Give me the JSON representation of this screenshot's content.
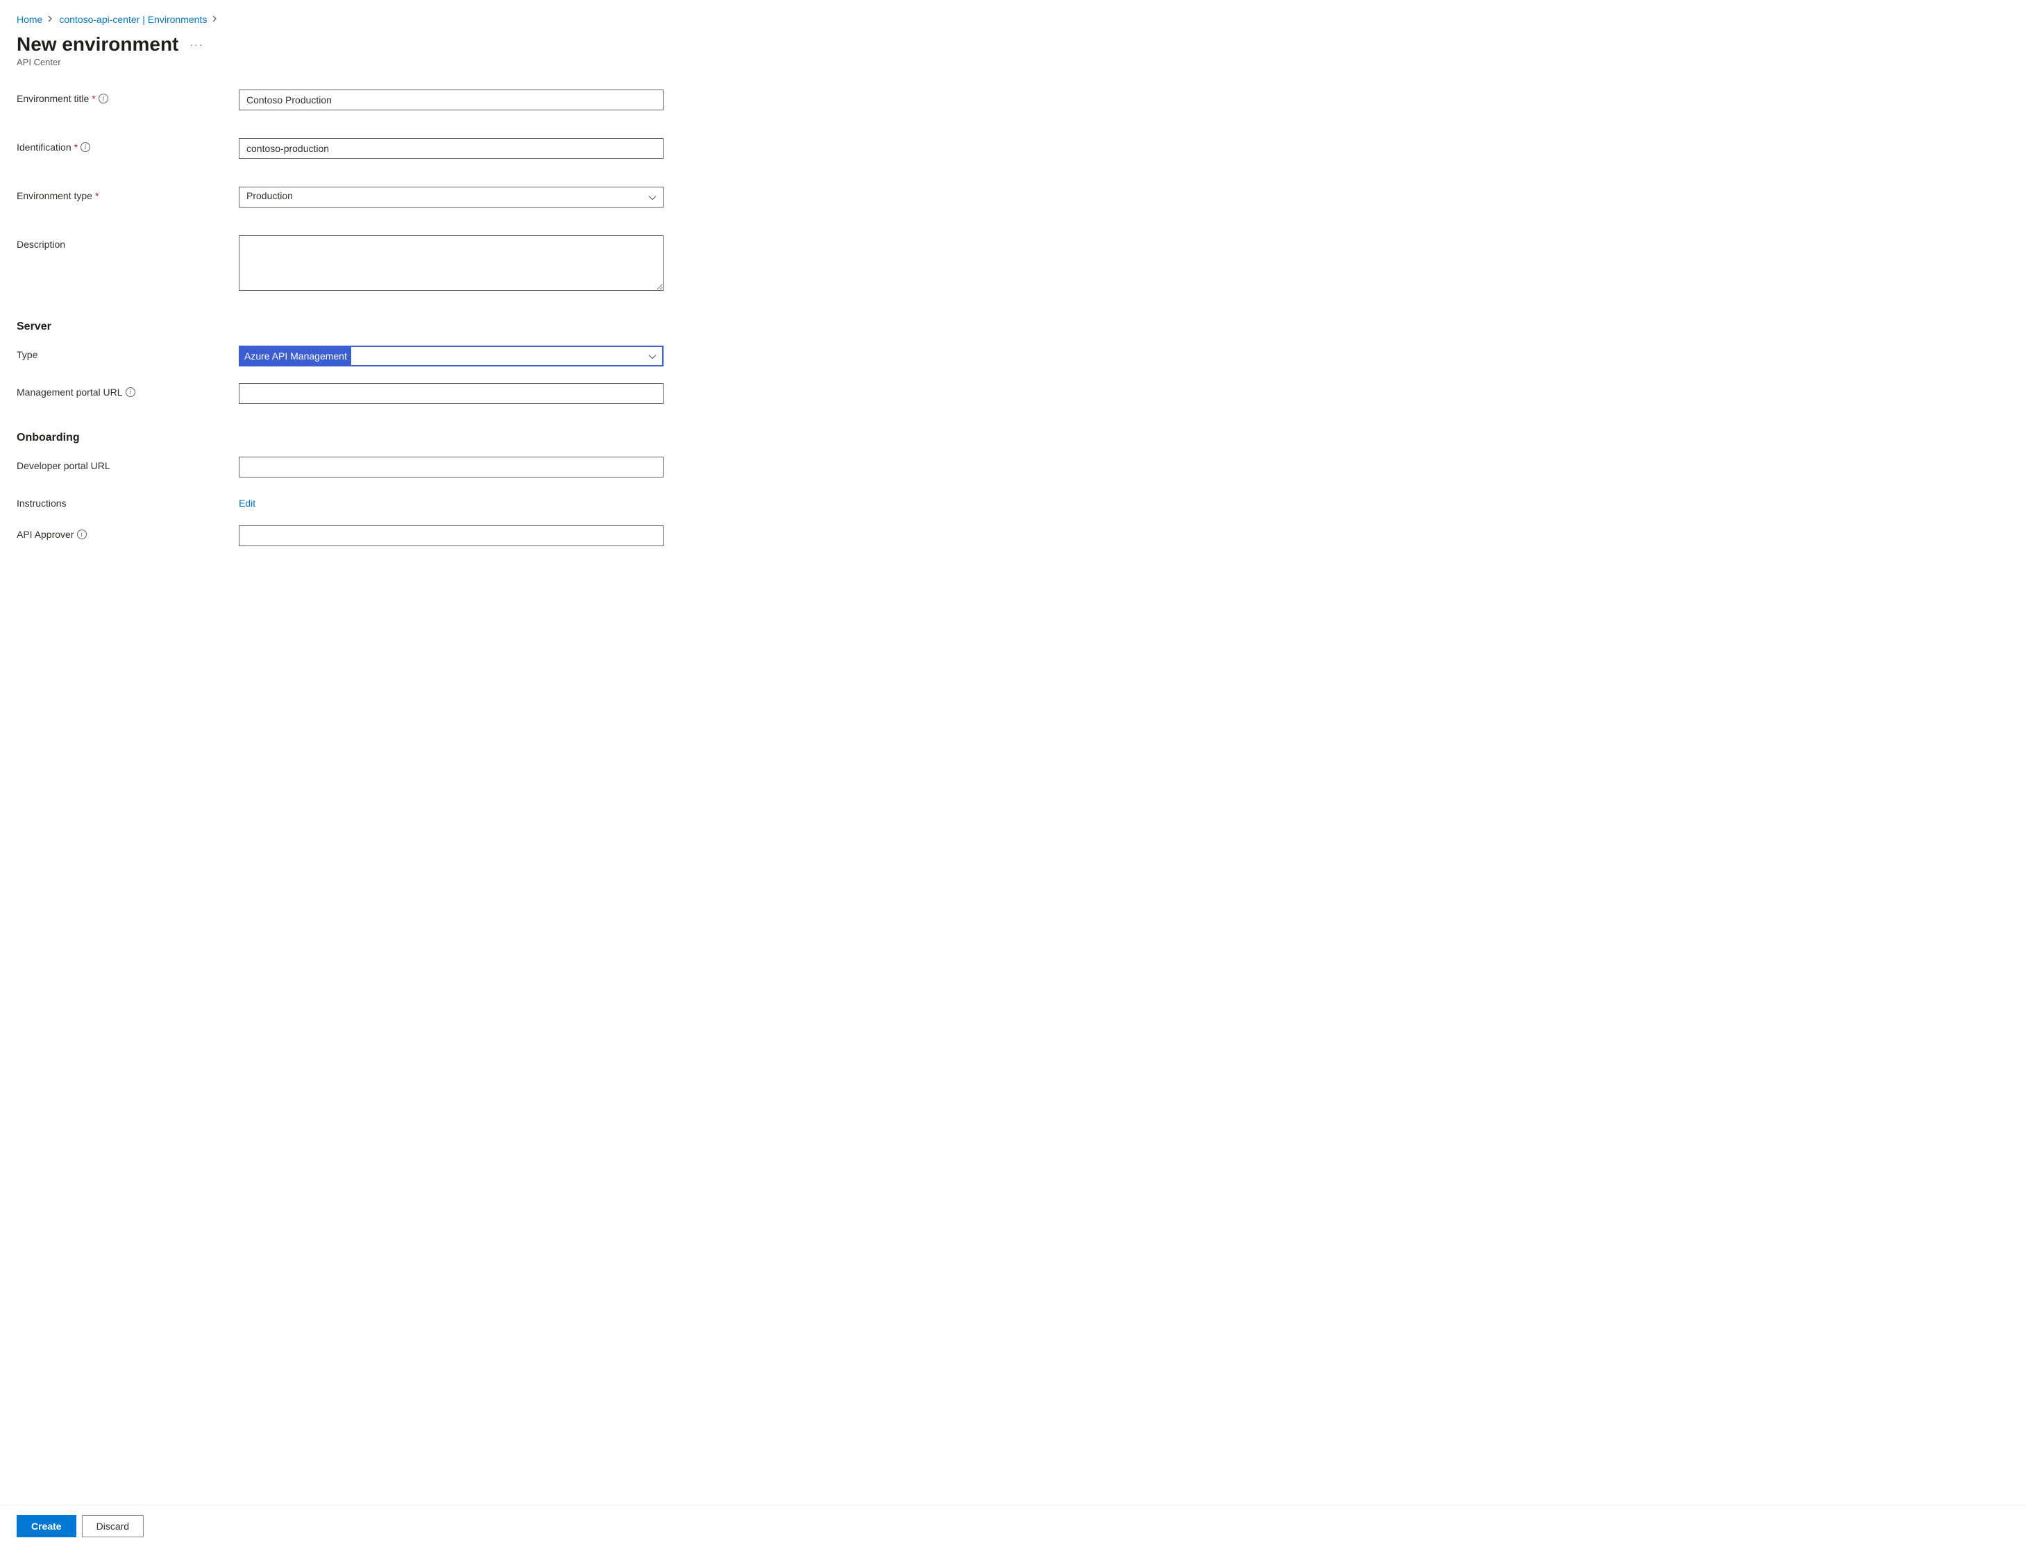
{
  "breadcrumb": {
    "items": [
      {
        "label": "Home"
      },
      {
        "label": "contoso-api-center | Environments"
      }
    ]
  },
  "header": {
    "title": "New environment",
    "subtitle": "API Center"
  },
  "form": {
    "env_title": {
      "label": "Environment title",
      "value": "Contoso Production"
    },
    "identification": {
      "label": "Identification",
      "value": "contoso-production"
    },
    "env_type": {
      "label": "Environment type",
      "value": "Production"
    },
    "description": {
      "label": "Description",
      "value": ""
    }
  },
  "server": {
    "heading": "Server",
    "type": {
      "label": "Type",
      "value": "Azure API Management"
    },
    "mgmt_url": {
      "label": "Management portal URL",
      "value": ""
    }
  },
  "onboarding": {
    "heading": "Onboarding",
    "dev_url": {
      "label": "Developer portal URL",
      "value": ""
    },
    "instructions": {
      "label": "Instructions",
      "action": "Edit"
    },
    "approver": {
      "label": "API Approver",
      "value": ""
    }
  },
  "footer": {
    "create": "Create",
    "discard": "Discard"
  }
}
